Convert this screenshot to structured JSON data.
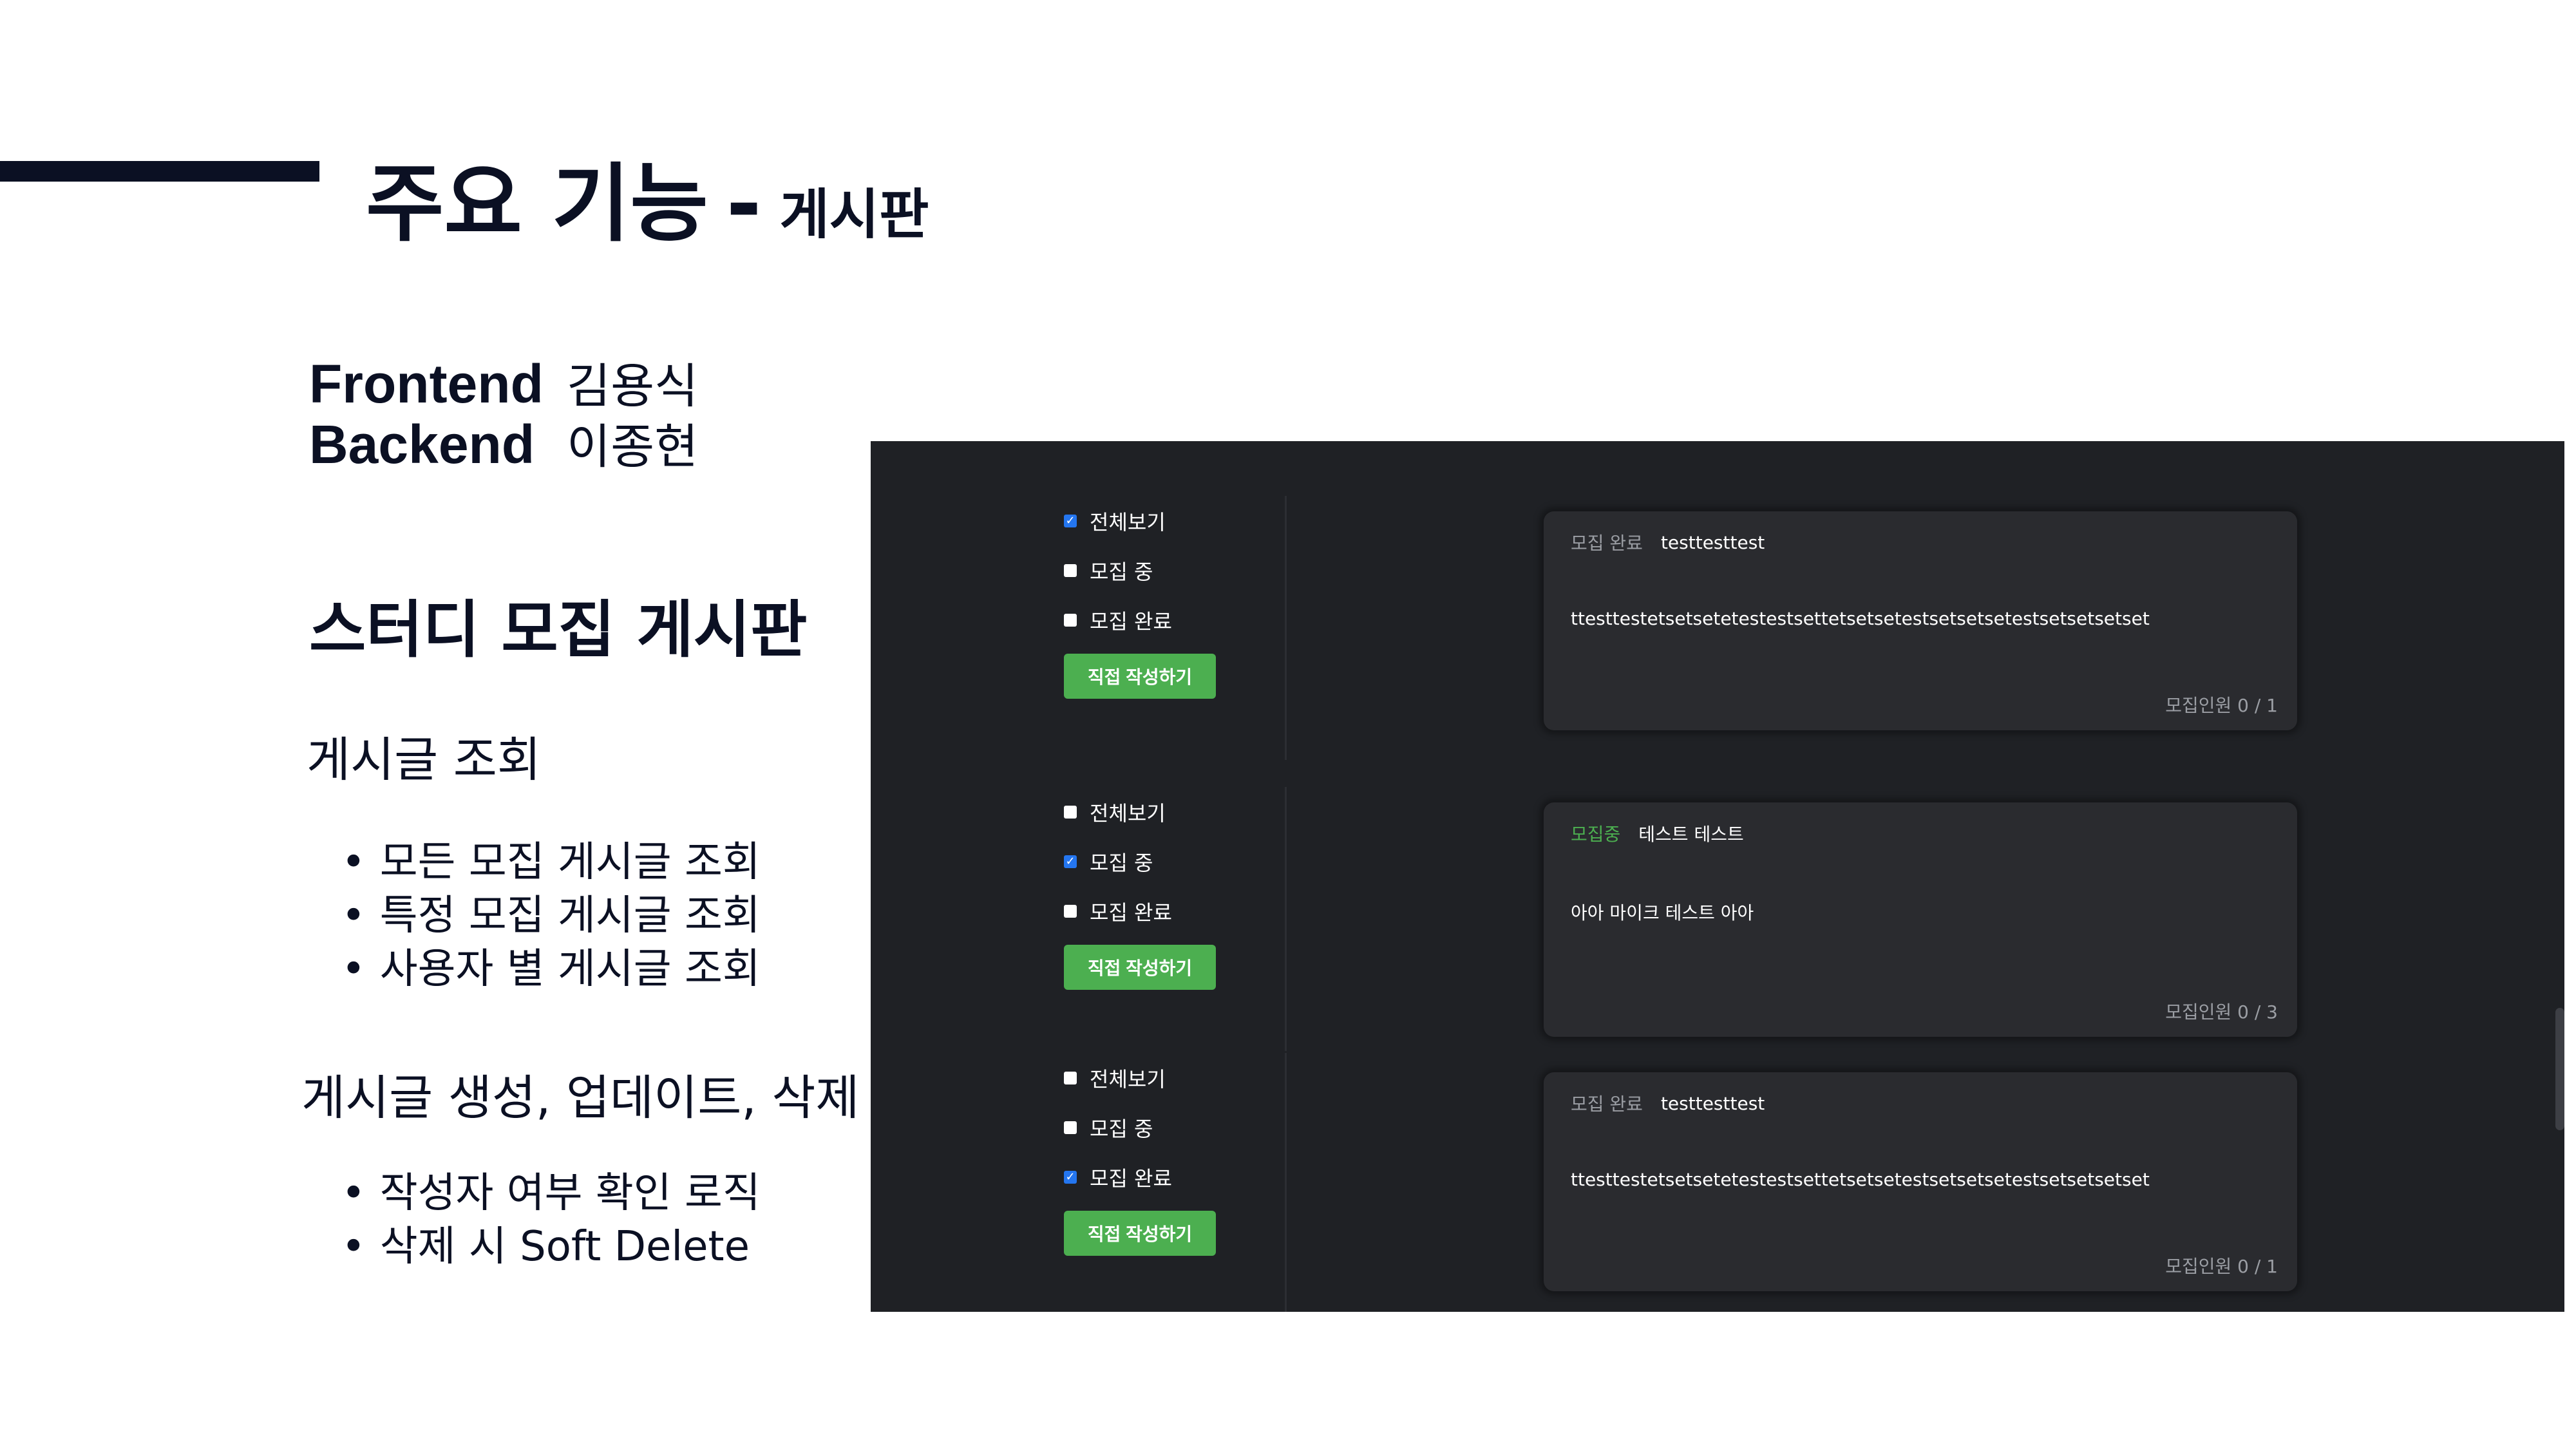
{
  "slide": {
    "title_main": "주요 기능",
    "title_dash": "-",
    "title_sub": "게시판",
    "team": [
      {
        "role": "Frontend",
        "name": "김용식"
      },
      {
        "role": "Backend",
        "name": "이종현"
      }
    ],
    "section_heading": "스터디 모집 게시판",
    "read_heading": "게시글 조회",
    "read_bullets": [
      "모든 모집 게시글 조회",
      "특정 모집 게시글 조회",
      "사용자 별 게시글 조회"
    ],
    "crud_heading": "게시글 생성, 업데이트, 삭제",
    "crud_bullets": [
      "작성자 여부 확인 로직",
      "삭제 시 Soft Delete"
    ]
  },
  "screens": [
    {
      "filters": [
        {
          "label": "전체보기",
          "checked": true
        },
        {
          "label": "모집 중",
          "checked": false
        },
        {
          "label": "모집 완료",
          "checked": false
        }
      ],
      "write_button": "직접 작성하기",
      "card": {
        "status": "모집 완료",
        "status_recruiting": false,
        "title": "testtesttest",
        "body": "ttesttestetsetsetetestestsettetsetsetestsetsetsetestsetsetsetset",
        "count": "모집인원 0 / 1"
      }
    },
    {
      "filters": [
        {
          "label": "전체보기",
          "checked": false
        },
        {
          "label": "모집 중",
          "checked": true
        },
        {
          "label": "모집 완료",
          "checked": false
        }
      ],
      "write_button": "직접 작성하기",
      "card": {
        "status": "모집중",
        "status_recruiting": true,
        "title": "테스트 테스트",
        "body": "아아 마이크 테스트 아아",
        "count": "모집인원 0 / 3"
      }
    },
    {
      "filters": [
        {
          "label": "전체보기",
          "checked": false
        },
        {
          "label": "모집 중",
          "checked": false
        },
        {
          "label": "모집 완료",
          "checked": true
        }
      ],
      "write_button": "직접 작성하기",
      "card": {
        "status": "모집 완료",
        "status_recruiting": false,
        "title": "testtesttest",
        "body": "ttesttestetsetsetetestestsettetsetsetestsetsetsetestsetsetsetset",
        "count": "모집인원 0 / 1"
      }
    }
  ],
  "colors": {
    "navy": "#0b1023",
    "panel_bg": "#1f2125",
    "card_bg": "#2a2b2f",
    "accent_green": "#4caf50",
    "checkbox_blue": "#2476f0"
  }
}
